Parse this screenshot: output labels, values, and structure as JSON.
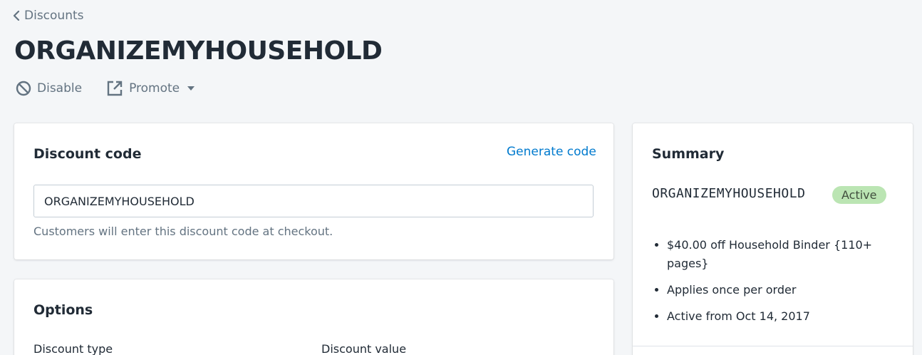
{
  "breadcrumb": {
    "label": "Discounts"
  },
  "page": {
    "title": "ORGANIZEMYHOUSEHOLD"
  },
  "actions": {
    "disable_label": "Disable",
    "promote_label": "Promote"
  },
  "discount_code_card": {
    "title": "Discount code",
    "generate_link": "Generate code",
    "input_value": "ORGANIZEMYHOUSEHOLD",
    "help_text": "Customers will enter this discount code at checkout."
  },
  "options_card": {
    "title": "Options",
    "discount_type_label": "Discount type",
    "discount_value_label": "Discount value"
  },
  "summary_card": {
    "title": "Summary",
    "code": "ORGANIZEMYHOUSEHOLD",
    "status_badge": "Active",
    "items": [
      "$40.00 off Household Binder {110+ pages}",
      "Applies once per order",
      "Active from Oct 14, 2017"
    ]
  },
  "colors": {
    "background": "#f4f6f8",
    "link": "#007ace",
    "badge_success": "#bbe5b3",
    "text_primary": "#212b36",
    "text_subdued": "#637381"
  }
}
